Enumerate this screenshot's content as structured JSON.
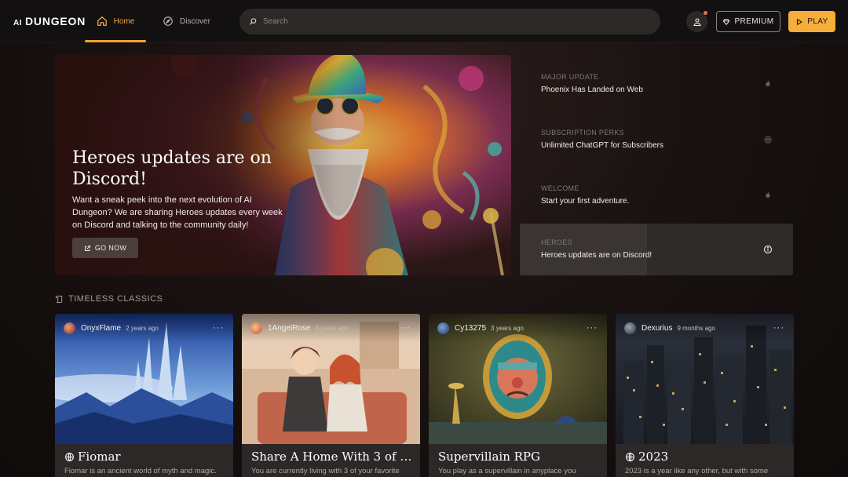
{
  "brand": {
    "ai": "AI",
    "name": "DUNGEON"
  },
  "nav": {
    "tabs": [
      {
        "label": "Home",
        "icon": "home-icon",
        "active": true
      },
      {
        "label": "Discover",
        "icon": "compass-icon",
        "active": false
      }
    ]
  },
  "search": {
    "placeholder": "Search",
    "value": ""
  },
  "actions": {
    "premium_label": "PREMIUM",
    "play_label": "PLAY"
  },
  "colors": {
    "accent": "#f2a233",
    "play_button": "#f5ae3b",
    "notification_dot": "#f26c3a",
    "background": "#100d0c"
  },
  "hero": {
    "title": "Heroes updates are on Discord!",
    "description": "Want a sneak peek into the next evolution of AI Dungeon? We are sharing Heroes updates every week on Discord and talking to the community daily!",
    "button_label": "GO NOW"
  },
  "news": [
    {
      "kicker": "MAJOR UPDATE",
      "title": "Phoenix Has Landed on Web",
      "icon": "flame-icon",
      "active": false
    },
    {
      "kicker": "SUBSCRIPTION PERKS",
      "title": "Unlimited ChatGPT for Subscribers",
      "icon": "settings-icon",
      "active": false
    },
    {
      "kicker": "WELCOME",
      "title": "Start your first adventure.",
      "icon": "flame-icon",
      "active": false
    },
    {
      "kicker": "HEROES",
      "title": "Heroes updates are on Discord!",
      "icon": "info-icon",
      "active": true
    }
  ],
  "section": {
    "title": "TIMELESS CLASSICS",
    "icon": "scroll-icon"
  },
  "cards": [
    {
      "author": "OnyxFlame",
      "age": "2 years ago",
      "title": "Fiomar",
      "globe": true,
      "description": "Fiomar is an ancient world of myth and magic.",
      "more": "···"
    },
    {
      "author": "1AngelRose",
      "age": "3 years ago",
      "title": "Share A Home With 3 of Yo...",
      "globe": false,
      "description": "You are currently living with 3 of your favorite",
      "more": "···"
    },
    {
      "author": "Cy13275",
      "age": "3 years ago",
      "title": "Supervillain RPG",
      "globe": false,
      "description": "You play as a supervillain in anyplace you",
      "more": "···"
    },
    {
      "author": "Dexurius",
      "age": "9 months ago",
      "title": "2023",
      "globe": true,
      "description": "2023 is a year like any other, but with some",
      "more": "···"
    }
  ]
}
